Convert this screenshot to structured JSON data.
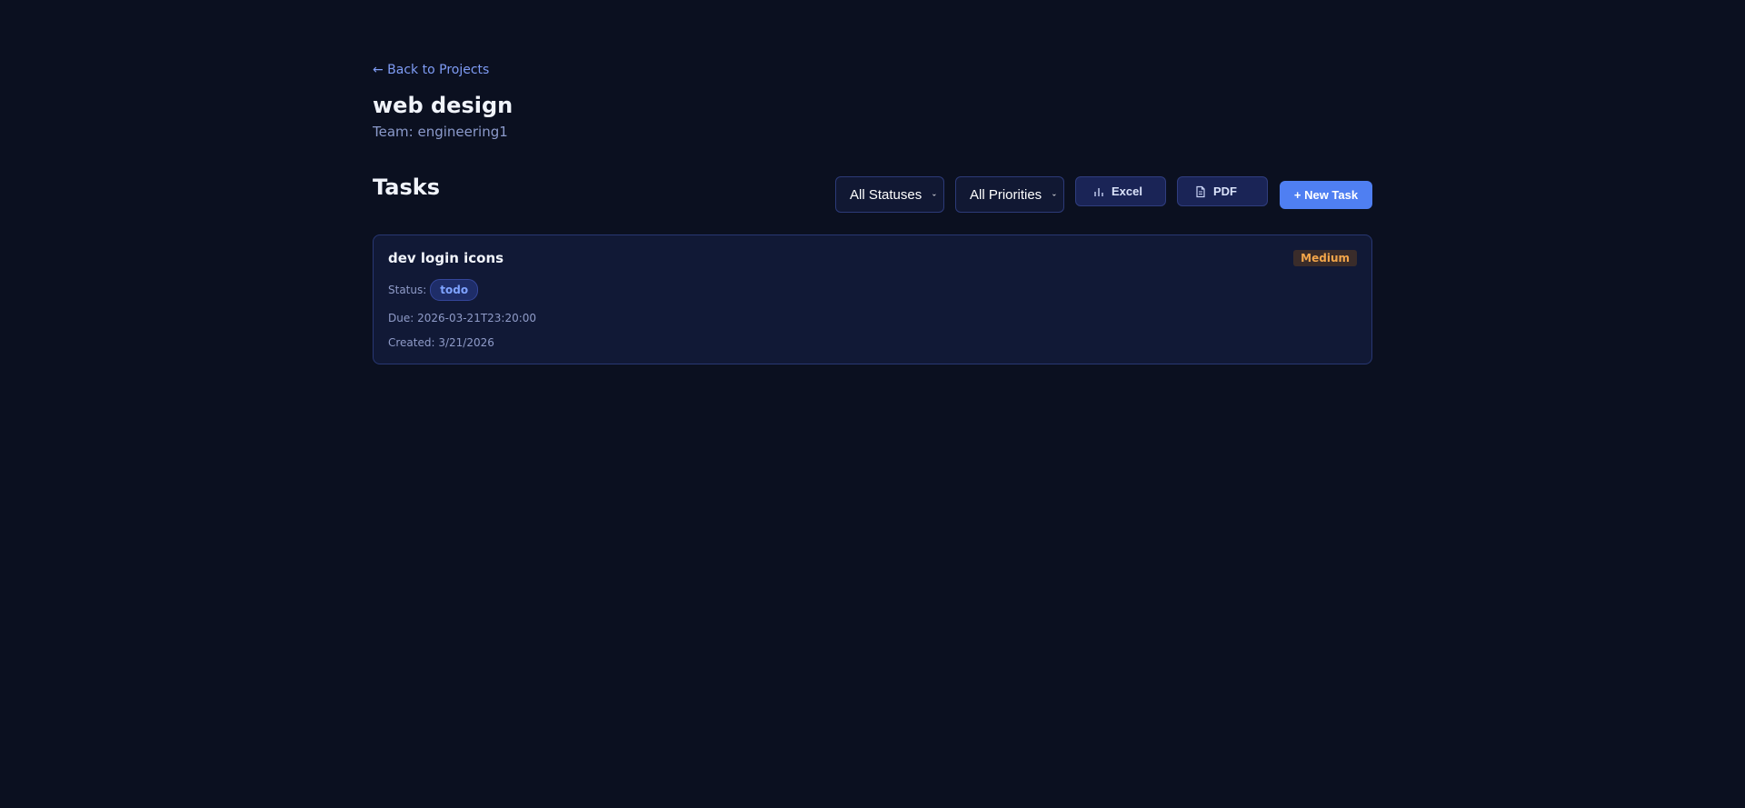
{
  "nav": {
    "back_label": "← Back to Projects"
  },
  "project": {
    "name": "web design",
    "team_line": "Team: engineering1"
  },
  "tasks_section": {
    "heading": "Tasks",
    "status_filter": {
      "selected": "All Statuses",
      "icon": "chevron-down-icon"
    },
    "priority_filter": {
      "selected": "All Priorities",
      "icon": "chevron-down-icon"
    },
    "export_excel": {
      "label": "Excel",
      "icon": "bar-chart-icon"
    },
    "export_pdf": {
      "label": "PDF",
      "icon": "document-icon"
    },
    "new_task_label": "+ New Task"
  },
  "tasks": [
    {
      "title": "dev login icons",
      "priority": "Medium",
      "status_label": "Status:",
      "status": "todo",
      "due": "Due: 2026-03-21T23:20:00",
      "created": "Created: 3/21/2026"
    }
  ],
  "colors": {
    "background": "#0b1020",
    "accent": "#4f7ff2",
    "card": "#111936",
    "priority_medium": "#f2a54a",
    "status_todo": "#7fa3ff"
  }
}
